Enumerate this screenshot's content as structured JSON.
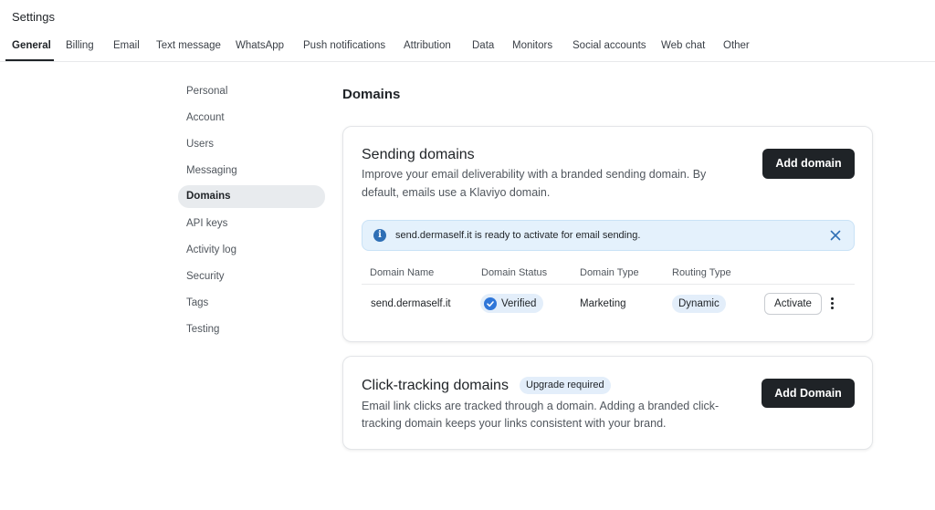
{
  "header": {
    "title": "Settings"
  },
  "top_tabs": [
    {
      "label": "General",
      "active": true
    },
    {
      "label": "Billing"
    },
    {
      "label": "Email"
    },
    {
      "label": "Text message"
    },
    {
      "label": "WhatsApp"
    },
    {
      "label": "Push notifications"
    },
    {
      "label": "Attribution"
    },
    {
      "label": "Data"
    },
    {
      "label": "Monitors"
    },
    {
      "label": "Social accounts"
    },
    {
      "label": "Web chat"
    },
    {
      "label": "Other"
    }
  ],
  "sidebar": {
    "items": [
      {
        "label": "Personal"
      },
      {
        "label": "Account"
      },
      {
        "label": "Users"
      },
      {
        "label": "Messaging"
      },
      {
        "label": "Domains",
        "active": true
      },
      {
        "label": "API keys"
      },
      {
        "label": "Activity log"
      },
      {
        "label": "Security"
      },
      {
        "label": "Tags"
      },
      {
        "label": "Testing"
      }
    ]
  },
  "main": {
    "section_title": "Domains",
    "sending": {
      "title": "Sending domains",
      "description_line1": "Improve your email deliverability with a branded sending domain. By",
      "description_line2": "default, emails use a Klaviyo domain.",
      "add_button": "Add domain",
      "banner_text": "send.dermaself.it is ready to activate for email sending.",
      "table": {
        "headers": [
          "Domain Name",
          "Domain Status",
          "Domain Type",
          "Routing Type"
        ],
        "rows": [
          {
            "name": "send.dermaself.it",
            "status": "Verified",
            "type": "Marketing",
            "routing": "Dynamic",
            "action": "Activate"
          }
        ]
      }
    },
    "click_tracking": {
      "title": "Click-tracking domains",
      "badge": "Upgrade required",
      "description_line1": "Email link clicks are tracked through a domain. Adding a branded click-",
      "description_line2": "tracking domain keeps your links consistent with your brand.",
      "add_button": "Add Domain"
    }
  },
  "colors": {
    "accent_dark": "#1f2327",
    "info_bg": "#e4f1fc",
    "badge_bg": "#e3eefa",
    "verified_icon": "#2f76d8"
  },
  "icons": [
    "info-icon",
    "close-icon",
    "check-circle-icon",
    "more-vertical-icon"
  ]
}
